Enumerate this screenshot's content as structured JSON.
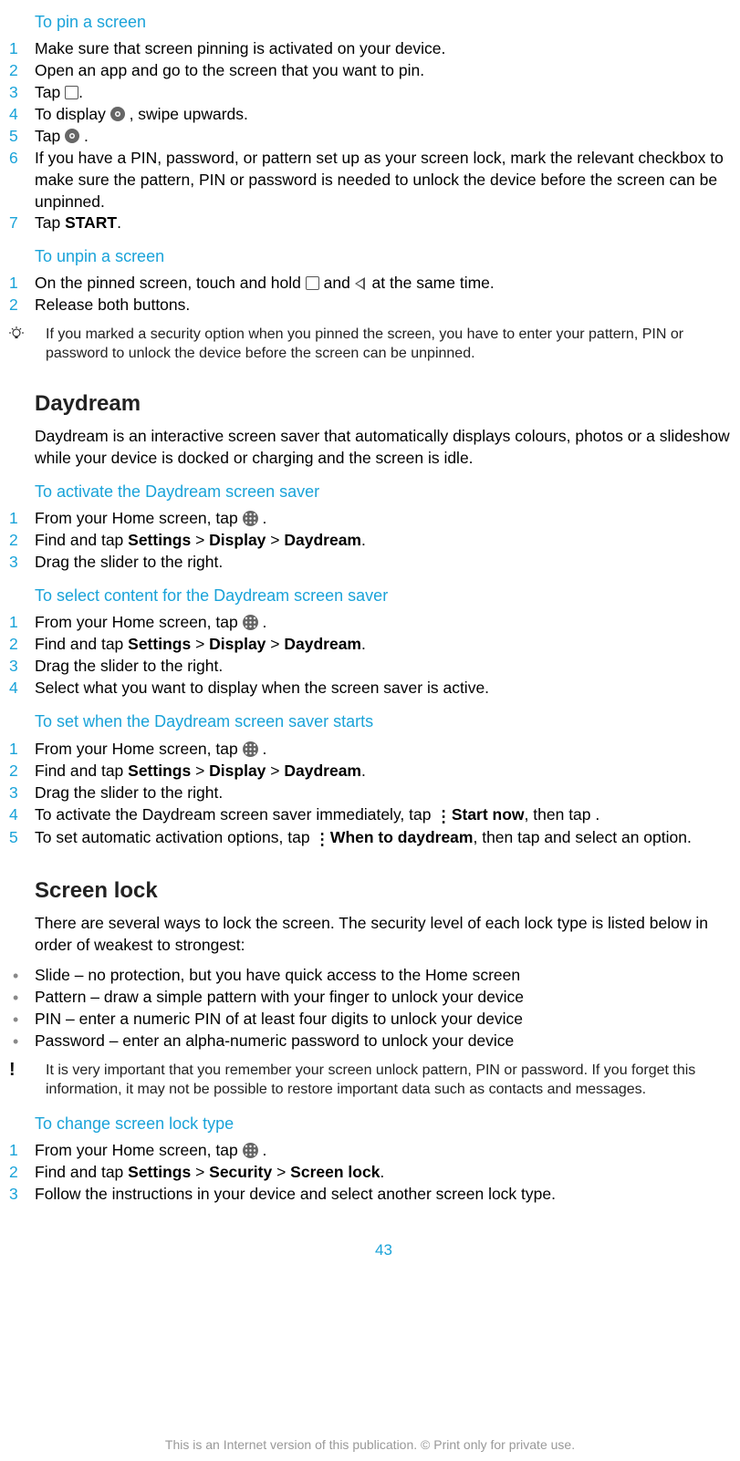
{
  "pin": {
    "heading": "To pin a screen",
    "steps": [
      {
        "n": "1",
        "text": "Make sure that screen pinning is activated on your device."
      },
      {
        "n": "2",
        "text": "Open an app and go to the screen that you want to pin."
      },
      {
        "n": "3",
        "pre": "Tap ",
        "icon": "overview-square-icon",
        "post": "."
      },
      {
        "n": "4",
        "pre": "To display ",
        "icon": "pin-circle-icon",
        "post": ", swipe upwards."
      },
      {
        "n": "5",
        "pre": "Tap ",
        "icon": "pin-circle-icon",
        "post": "."
      },
      {
        "n": "6",
        "text": "If you have a PIN, password, or pattern set up as your screen lock, mark the relevant checkbox to make sure the pattern, PIN or password is needed to unlock the device before the screen can be unpinned."
      },
      {
        "n": "7",
        "pre": "Tap ",
        "bold": "START",
        "post": "."
      }
    ]
  },
  "unpin": {
    "heading": "To unpin a screen",
    "steps": [
      {
        "n": "1",
        "pre": "On the pinned screen, touch and hold ",
        "icon": "overview-square-icon",
        "mid": " and ",
        "icon2": "back-triangle-icon",
        "post": " at the same time."
      },
      {
        "n": "2",
        "text": "Release both buttons."
      }
    ],
    "note": "If you marked a security option when you pinned the screen, you have to enter your pattern, PIN or password to unlock the device before the screen can be unpinned."
  },
  "daydream": {
    "title": "Daydream",
    "desc": "Daydream is an interactive screen saver that automatically displays colours, photos or a slideshow while your device is docked or charging and the screen is idle.",
    "activate": {
      "heading": "To activate the Daydream screen saver",
      "steps": [
        {
          "n": "1",
          "pre": "From your Home screen, tap ",
          "icon": "app-grid-icon",
          "post": " ."
        },
        {
          "n": "2",
          "pre": "Find and tap ",
          "bold": "Settings",
          "mid": " > ",
          "bold2": "Display",
          "mid2": " > ",
          "bold3": "Daydream",
          "post": "."
        },
        {
          "n": "3",
          "text": "Drag the slider to the right."
        }
      ]
    },
    "select": {
      "heading": "To select content for the Daydream screen saver",
      "steps": [
        {
          "n": "1",
          "pre": "From your Home screen, tap ",
          "icon": "app-grid-icon",
          "post": " ."
        },
        {
          "n": "2",
          "pre": "Find and tap ",
          "bold": "Settings",
          "mid": " > ",
          "bold2": "Display",
          "mid2": " > ",
          "bold3": "Daydream",
          "post": "."
        },
        {
          "n": "3",
          "text": "Drag the slider to the right."
        },
        {
          "n": "4",
          "text": "Select what you want to display when the screen saver is active."
        }
      ]
    },
    "when": {
      "heading": "To set when the Daydream screen saver starts",
      "steps": [
        {
          "n": "1",
          "pre": "From your Home screen, tap ",
          "icon": "app-grid-icon",
          "post": " ."
        },
        {
          "n": "2",
          "pre": "Find and tap ",
          "bold": "Settings",
          "mid": " > ",
          "bold2": "Display",
          "mid2": " > ",
          "bold3": "Daydream",
          "post": "."
        },
        {
          "n": "3",
          "text": "Drag the slider to the right."
        },
        {
          "n": "4",
          "pre": "To activate the Daydream screen saver immediately, tap ",
          "icon": "more-vert-icon",
          "mid": ", then tap ",
          "bold": "Start now",
          "post": "."
        },
        {
          "n": "5",
          "pre": "To set automatic activation options, tap ",
          "icon": "more-vert-icon",
          "mid": ", then tap ",
          "bold": "When to daydream",
          "post": " and select an option."
        }
      ]
    }
  },
  "screenlock": {
    "title": "Screen lock",
    "desc": "There are several ways to lock the screen. The security level of each lock type is listed below in order of weakest to strongest:",
    "bullets": [
      "Slide – no protection, but you have quick access to the Home screen",
      "Pattern – draw a simple pattern with your finger to unlock your device",
      "PIN – enter a numeric PIN of at least four digits to unlock your device",
      "Password – enter an alpha-numeric password to unlock your device"
    ],
    "note": "It is very important that you remember your screen unlock pattern, PIN or password. If you forget this information, it may not be possible to restore important data such as contacts and messages.",
    "change": {
      "heading": "To change screen lock type",
      "steps": [
        {
          "n": "1",
          "pre": "From your Home screen, tap ",
          "icon": "app-grid-icon",
          "post": " ."
        },
        {
          "n": "2",
          "pre": "Find and tap ",
          "bold": "Settings",
          "mid": " > ",
          "bold2": "Security",
          "mid2": " > ",
          "bold3": "Screen lock",
          "post": "."
        },
        {
          "n": "3",
          "text": "Follow the instructions in your device and select another screen lock type."
        }
      ]
    }
  },
  "pagenum": "43",
  "footer": "This is an Internet version of this publication. © Print only for private use."
}
